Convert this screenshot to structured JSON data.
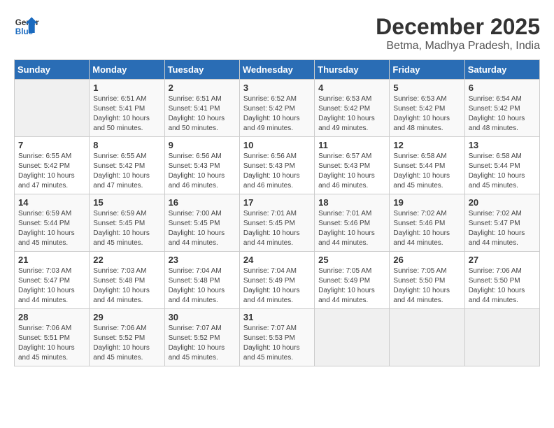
{
  "logo": {
    "line1": "General",
    "line2": "Blue"
  },
  "title": "December 2025",
  "location": "Betma, Madhya Pradesh, India",
  "days_of_week": [
    "Sunday",
    "Monday",
    "Tuesday",
    "Wednesday",
    "Thursday",
    "Friday",
    "Saturday"
  ],
  "weeks": [
    [
      {
        "day": "",
        "info": ""
      },
      {
        "day": "1",
        "info": "Sunrise: 6:51 AM\nSunset: 5:41 PM\nDaylight: 10 hours\nand 50 minutes."
      },
      {
        "day": "2",
        "info": "Sunrise: 6:51 AM\nSunset: 5:41 PM\nDaylight: 10 hours\nand 50 minutes."
      },
      {
        "day": "3",
        "info": "Sunrise: 6:52 AM\nSunset: 5:42 PM\nDaylight: 10 hours\nand 49 minutes."
      },
      {
        "day": "4",
        "info": "Sunrise: 6:53 AM\nSunset: 5:42 PM\nDaylight: 10 hours\nand 49 minutes."
      },
      {
        "day": "5",
        "info": "Sunrise: 6:53 AM\nSunset: 5:42 PM\nDaylight: 10 hours\nand 48 minutes."
      },
      {
        "day": "6",
        "info": "Sunrise: 6:54 AM\nSunset: 5:42 PM\nDaylight: 10 hours\nand 48 minutes."
      }
    ],
    [
      {
        "day": "7",
        "info": "Sunrise: 6:55 AM\nSunset: 5:42 PM\nDaylight: 10 hours\nand 47 minutes."
      },
      {
        "day": "8",
        "info": "Sunrise: 6:55 AM\nSunset: 5:42 PM\nDaylight: 10 hours\nand 47 minutes."
      },
      {
        "day": "9",
        "info": "Sunrise: 6:56 AM\nSunset: 5:43 PM\nDaylight: 10 hours\nand 46 minutes."
      },
      {
        "day": "10",
        "info": "Sunrise: 6:56 AM\nSunset: 5:43 PM\nDaylight: 10 hours\nand 46 minutes."
      },
      {
        "day": "11",
        "info": "Sunrise: 6:57 AM\nSunset: 5:43 PM\nDaylight: 10 hours\nand 46 minutes."
      },
      {
        "day": "12",
        "info": "Sunrise: 6:58 AM\nSunset: 5:44 PM\nDaylight: 10 hours\nand 45 minutes."
      },
      {
        "day": "13",
        "info": "Sunrise: 6:58 AM\nSunset: 5:44 PM\nDaylight: 10 hours\nand 45 minutes."
      }
    ],
    [
      {
        "day": "14",
        "info": "Sunrise: 6:59 AM\nSunset: 5:44 PM\nDaylight: 10 hours\nand 45 minutes."
      },
      {
        "day": "15",
        "info": "Sunrise: 6:59 AM\nSunset: 5:45 PM\nDaylight: 10 hours\nand 45 minutes."
      },
      {
        "day": "16",
        "info": "Sunrise: 7:00 AM\nSunset: 5:45 PM\nDaylight: 10 hours\nand 44 minutes."
      },
      {
        "day": "17",
        "info": "Sunrise: 7:01 AM\nSunset: 5:45 PM\nDaylight: 10 hours\nand 44 minutes."
      },
      {
        "day": "18",
        "info": "Sunrise: 7:01 AM\nSunset: 5:46 PM\nDaylight: 10 hours\nand 44 minutes."
      },
      {
        "day": "19",
        "info": "Sunrise: 7:02 AM\nSunset: 5:46 PM\nDaylight: 10 hours\nand 44 minutes."
      },
      {
        "day": "20",
        "info": "Sunrise: 7:02 AM\nSunset: 5:47 PM\nDaylight: 10 hours\nand 44 minutes."
      }
    ],
    [
      {
        "day": "21",
        "info": "Sunrise: 7:03 AM\nSunset: 5:47 PM\nDaylight: 10 hours\nand 44 minutes."
      },
      {
        "day": "22",
        "info": "Sunrise: 7:03 AM\nSunset: 5:48 PM\nDaylight: 10 hours\nand 44 minutes."
      },
      {
        "day": "23",
        "info": "Sunrise: 7:04 AM\nSunset: 5:48 PM\nDaylight: 10 hours\nand 44 minutes."
      },
      {
        "day": "24",
        "info": "Sunrise: 7:04 AM\nSunset: 5:49 PM\nDaylight: 10 hours\nand 44 minutes."
      },
      {
        "day": "25",
        "info": "Sunrise: 7:05 AM\nSunset: 5:49 PM\nDaylight: 10 hours\nand 44 minutes."
      },
      {
        "day": "26",
        "info": "Sunrise: 7:05 AM\nSunset: 5:50 PM\nDaylight: 10 hours\nand 44 minutes."
      },
      {
        "day": "27",
        "info": "Sunrise: 7:06 AM\nSunset: 5:50 PM\nDaylight: 10 hours\nand 44 minutes."
      }
    ],
    [
      {
        "day": "28",
        "info": "Sunrise: 7:06 AM\nSunset: 5:51 PM\nDaylight: 10 hours\nand 45 minutes."
      },
      {
        "day": "29",
        "info": "Sunrise: 7:06 AM\nSunset: 5:52 PM\nDaylight: 10 hours\nand 45 minutes."
      },
      {
        "day": "30",
        "info": "Sunrise: 7:07 AM\nSunset: 5:52 PM\nDaylight: 10 hours\nand 45 minutes."
      },
      {
        "day": "31",
        "info": "Sunrise: 7:07 AM\nSunset: 5:53 PM\nDaylight: 10 hours\nand 45 minutes."
      },
      {
        "day": "",
        "info": ""
      },
      {
        "day": "",
        "info": ""
      },
      {
        "day": "",
        "info": ""
      }
    ]
  ]
}
